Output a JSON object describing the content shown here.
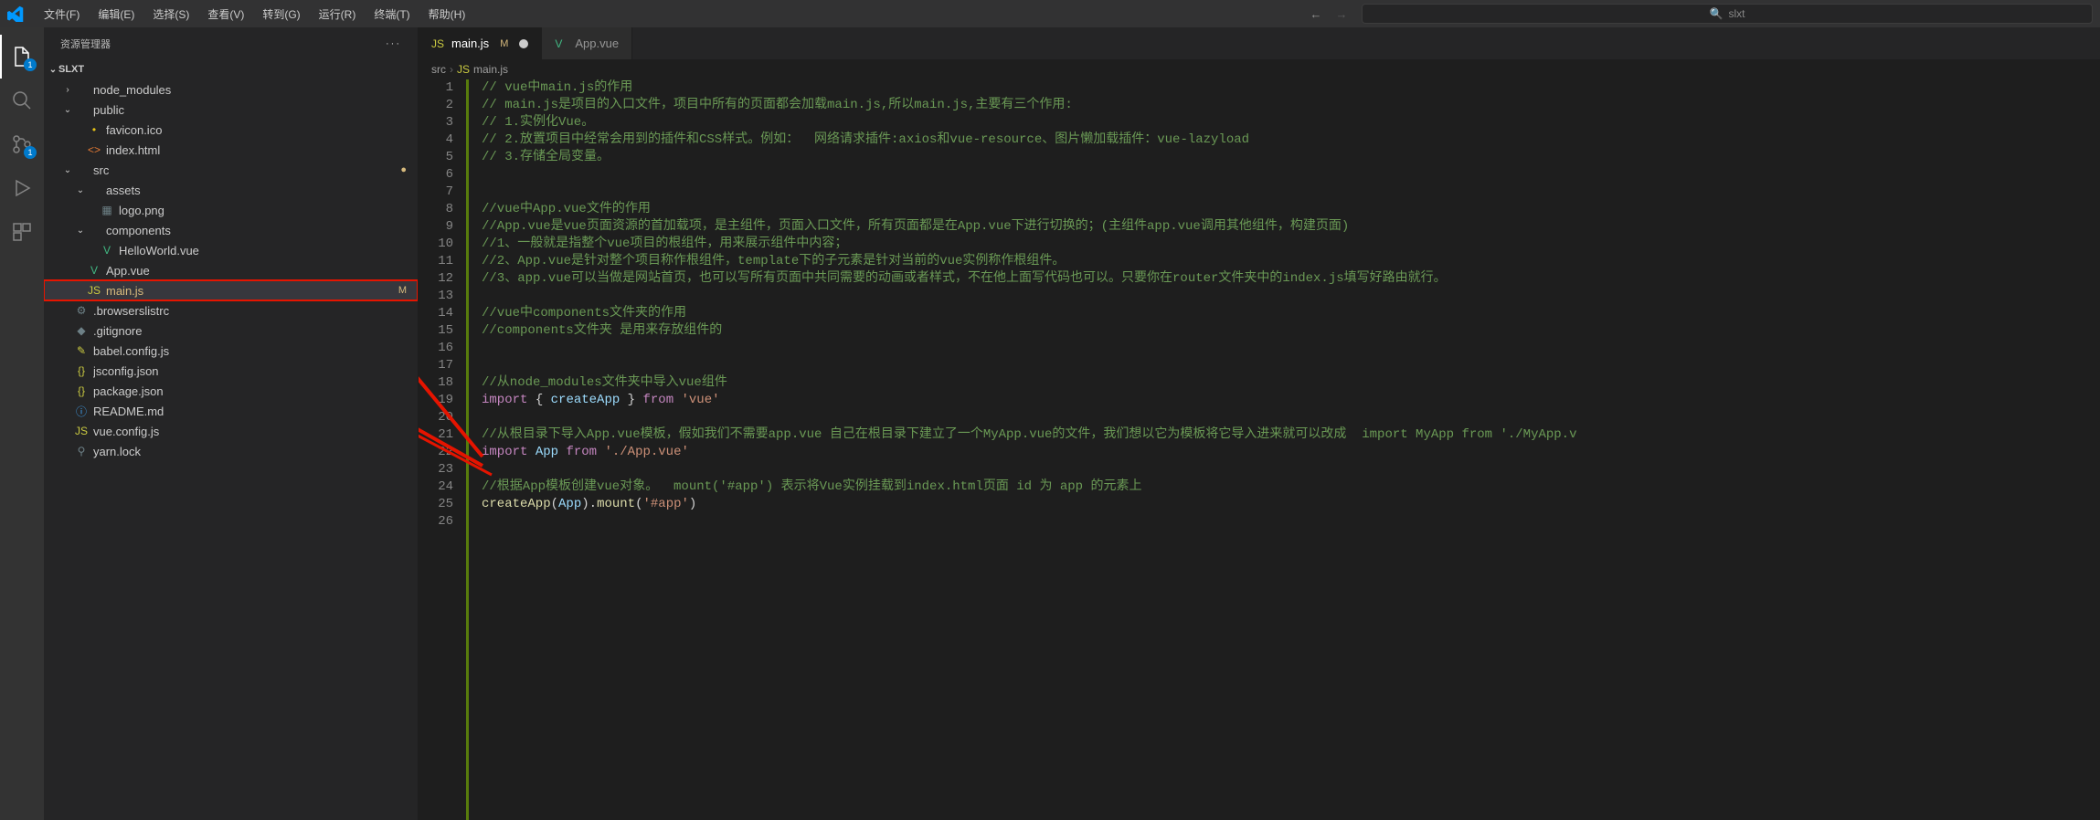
{
  "menubar": {
    "items": [
      "文件(F)",
      "编辑(E)",
      "选择(S)",
      "查看(V)",
      "转到(G)",
      "运行(R)",
      "终端(T)",
      "帮助(H)"
    ],
    "search_text": "slxt"
  },
  "activitybar": {
    "explorer_badge": "1",
    "scm_badge": "1"
  },
  "sidebar": {
    "title": "资源管理器",
    "root": "SLXT",
    "tree": [
      {
        "type": "folder",
        "name": "node_modules",
        "depth": 1,
        "open": false,
        "chev": "›"
      },
      {
        "type": "folder",
        "name": "public",
        "depth": 1,
        "open": true,
        "chev": "⌄"
      },
      {
        "type": "file",
        "name": "favicon.ico",
        "depth": 2,
        "icon": "star",
        "cls": "ico-star"
      },
      {
        "type": "file",
        "name": "index.html",
        "depth": 2,
        "icon": "html",
        "cls": "ico-html",
        "glyph": "<>"
      },
      {
        "type": "folder",
        "name": "src",
        "depth": 1,
        "open": true,
        "chev": "⌄",
        "status": "●",
        "statusColor": "#d7ba7d"
      },
      {
        "type": "folder",
        "name": "assets",
        "depth": 2,
        "open": true,
        "chev": "⌄"
      },
      {
        "type": "file",
        "name": "logo.png",
        "depth": 3,
        "icon": "img",
        "cls": "ico-config",
        "glyph": "▦"
      },
      {
        "type": "folder",
        "name": "components",
        "depth": 2,
        "open": true,
        "chev": "⌄"
      },
      {
        "type": "file",
        "name": "HelloWorld.vue",
        "depth": 3,
        "icon": "vue",
        "cls": "ico-vue",
        "glyph": "V"
      },
      {
        "type": "file",
        "name": "App.vue",
        "depth": 2,
        "icon": "vue",
        "cls": "ico-vue",
        "glyph": "V"
      },
      {
        "type": "file",
        "name": "main.js",
        "depth": 2,
        "icon": "js",
        "cls": "ico-js",
        "glyph": "JS",
        "selected": true,
        "status": "M"
      },
      {
        "type": "file",
        "name": ".browserslistrc",
        "depth": 1,
        "icon": "config",
        "cls": "ico-config",
        "glyph": "⚙"
      },
      {
        "type": "file",
        "name": ".gitignore",
        "depth": 1,
        "icon": "config",
        "cls": "ico-config",
        "glyph": "◆"
      },
      {
        "type": "file",
        "name": "babel.config.js",
        "depth": 1,
        "icon": "js",
        "cls": "ico-js",
        "glyph": "✎"
      },
      {
        "type": "file",
        "name": "jsconfig.json",
        "depth": 1,
        "icon": "json",
        "cls": "ico-json",
        "glyph": "{}"
      },
      {
        "type": "file",
        "name": "package.json",
        "depth": 1,
        "icon": "json",
        "cls": "ico-json",
        "glyph": "{}"
      },
      {
        "type": "file",
        "name": "README.md",
        "depth": 1,
        "icon": "md",
        "cls": "ico-md",
        "glyph": "ⓘ"
      },
      {
        "type": "file",
        "name": "vue.config.js",
        "depth": 1,
        "icon": "js",
        "cls": "ico-js",
        "glyph": "JS"
      },
      {
        "type": "file",
        "name": "yarn.lock",
        "depth": 1,
        "icon": "lock",
        "cls": "ico-lock",
        "glyph": "⚲"
      }
    ]
  },
  "tabs": [
    {
      "label": "main.js",
      "icon": "JS",
      "cls": "ico-js",
      "active": true,
      "status": "M",
      "dirty": true
    },
    {
      "label": "App.vue",
      "icon": "V",
      "cls": "ico-vue",
      "active": false
    }
  ],
  "breadcrumb": {
    "parts": [
      "src",
      "main.js"
    ],
    "icon": "JS"
  },
  "code_lines": [
    {
      "n": 1,
      "tokens": [
        {
          "t": "// vue中main.js的作用",
          "c": "c-comment"
        }
      ]
    },
    {
      "n": 2,
      "tokens": [
        {
          "t": "// main.js是项目的入口文件，项目中所有的页面都会加载main.js,所以main.js,主要有三个作用:",
          "c": "c-comment"
        }
      ]
    },
    {
      "n": 3,
      "tokens": [
        {
          "t": "// 1.实例化Vue。",
          "c": "c-comment"
        }
      ]
    },
    {
      "n": 4,
      "tokens": [
        {
          "t": "// 2.放置项目中经常会用到的插件和CSS样式。例如：  网络请求插件:axios和vue-resource、图片懒加载插件：vue-lazyload",
          "c": "c-comment"
        }
      ]
    },
    {
      "n": 5,
      "tokens": [
        {
          "t": "// 3.存储全局变量。",
          "c": "c-comment"
        }
      ]
    },
    {
      "n": 6,
      "tokens": [
        {
          "t": "",
          "c": "c-plain"
        }
      ]
    },
    {
      "n": 7,
      "tokens": [
        {
          "t": "",
          "c": "c-plain"
        }
      ]
    },
    {
      "n": 8,
      "tokens": [
        {
          "t": "//vue中App.vue文件的作用",
          "c": "c-comment"
        }
      ]
    },
    {
      "n": 9,
      "tokens": [
        {
          "t": "//App.vue是vue页面资源的首加载项，是主组件，页面入口文件，所有页面都是在App.vue下进行切换的；(主组件app.vue调用其他组件，构建页面)",
          "c": "c-comment"
        }
      ]
    },
    {
      "n": 10,
      "tokens": [
        {
          "t": "//1、一般就是指整个vue项目的根组件，用来展示组件中内容；",
          "c": "c-comment"
        }
      ]
    },
    {
      "n": 11,
      "tokens": [
        {
          "t": "//2、App.vue是针对整个项目称作根组件，template下的子元素是针对当前的vue实例称作根组件。",
          "c": "c-comment"
        }
      ]
    },
    {
      "n": 12,
      "tokens": [
        {
          "t": "//3、app.vue可以当做是网站首页，也可以写所有页面中共同需要的动画或者样式，不在他上面写代码也可以。只要你在router文件夹中的index.js填写好路由就行。",
          "c": "c-comment"
        }
      ]
    },
    {
      "n": 13,
      "tokens": [
        {
          "t": "",
          "c": "c-plain"
        }
      ]
    },
    {
      "n": 14,
      "tokens": [
        {
          "t": "//vue中components文件夹的作用",
          "c": "c-comment"
        }
      ]
    },
    {
      "n": 15,
      "tokens": [
        {
          "t": "//components文件夹 是用来存放组件的",
          "c": "c-comment"
        }
      ]
    },
    {
      "n": 16,
      "tokens": [
        {
          "t": "",
          "c": "c-plain"
        }
      ]
    },
    {
      "n": 17,
      "tokens": [
        {
          "t": "",
          "c": "c-plain"
        }
      ]
    },
    {
      "n": 18,
      "tokens": [
        {
          "t": "//从node_modules文件夹中导入vue组件",
          "c": "c-comment"
        }
      ]
    },
    {
      "n": 19,
      "tokens": [
        {
          "t": "import",
          "c": "c-kw"
        },
        {
          "t": " { ",
          "c": "c-plain"
        },
        {
          "t": "createApp",
          "c": "c-var"
        },
        {
          "t": " } ",
          "c": "c-plain"
        },
        {
          "t": "from",
          "c": "c-kw"
        },
        {
          "t": " ",
          "c": "c-plain"
        },
        {
          "t": "'vue'",
          "c": "c-str"
        }
      ]
    },
    {
      "n": 20,
      "tokens": [
        {
          "t": "",
          "c": "c-plain"
        }
      ]
    },
    {
      "n": 21,
      "tokens": [
        {
          "t": "//从根目录下导入App.vue模板，假如我们不需要app.vue 自己在根目录下建立了一个MyApp.vue的文件，我们想以它为模板将它导入进来就可以改成  import MyApp from './MyApp.v",
          "c": "c-comment"
        }
      ]
    },
    {
      "n": 22,
      "tokens": [
        {
          "t": "import",
          "c": "c-kw"
        },
        {
          "t": " ",
          "c": "c-plain"
        },
        {
          "t": "App",
          "c": "c-var"
        },
        {
          "t": " ",
          "c": "c-plain"
        },
        {
          "t": "from",
          "c": "c-kw"
        },
        {
          "t": " ",
          "c": "c-plain"
        },
        {
          "t": "'./App.vue'",
          "c": "c-str"
        }
      ]
    },
    {
      "n": 23,
      "tokens": [
        {
          "t": "",
          "c": "c-plain"
        }
      ]
    },
    {
      "n": 24,
      "tokens": [
        {
          "t": "//根据App模板创建vue对象。  mount('#app') 表示将Vue实例挂载到index.html页面 id 为 app 的元素上",
          "c": "c-comment"
        }
      ]
    },
    {
      "n": 25,
      "tokens": [
        {
          "t": "createApp",
          "c": "c-fn"
        },
        {
          "t": "(",
          "c": "c-plain"
        },
        {
          "t": "App",
          "c": "c-var"
        },
        {
          "t": ").",
          "c": "c-plain"
        },
        {
          "t": "mount",
          "c": "c-fn"
        },
        {
          "t": "(",
          "c": "c-plain"
        },
        {
          "t": "'#app'",
          "c": "c-str"
        },
        {
          "t": ")",
          "c": "c-plain"
        }
      ]
    },
    {
      "n": 26,
      "tokens": [
        {
          "t": "",
          "c": "c-plain"
        }
      ]
    }
  ]
}
